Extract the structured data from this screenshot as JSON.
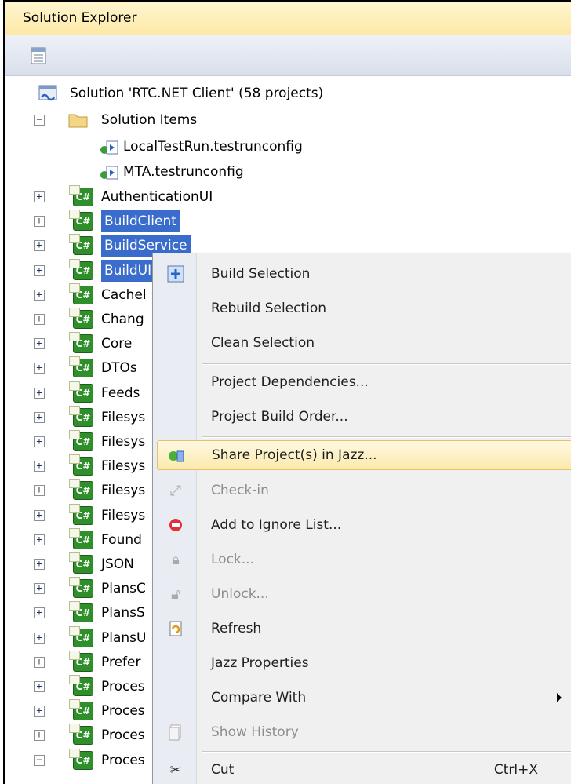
{
  "window": {
    "title": "Solution Explorer"
  },
  "toolbar": {
    "properties_icon": "properties-icon"
  },
  "solution": {
    "label": "Solution 'RTC.NET Client' (58 projects)",
    "items_folder": "Solution Items",
    "files": [
      "LocalTestRun.testrunconfig",
      "MTA.testrunconfig"
    ]
  },
  "projects": [
    "AuthenticationUI",
    "BuildClient",
    "BuildService",
    "BuildUI",
    "Cachel",
    "Chang",
    "Core",
    "DTOs",
    "Feeds",
    "Filesys",
    "Filesys",
    "Filesys",
    "Filesys",
    "Filesys",
    "Found",
    "JSON",
    "PlansC",
    "PlansS",
    "PlansU",
    "Prefer",
    "Proces",
    "Proces",
    "Proces",
    "Proces"
  ],
  "context_menu": {
    "items": [
      {
        "label": "Build Selection",
        "icon": "build-icon"
      },
      {
        "label": "Rebuild Selection"
      },
      {
        "label": "Clean Selection"
      },
      {
        "label": "Project Dependencies..."
      },
      {
        "label": "Project Build Order..."
      },
      {
        "label": "Share Project(s) in Jazz...",
        "icon": "share-jazz-icon"
      },
      {
        "label": "Check-in",
        "icon": "check-in-icon"
      },
      {
        "label": "Add to Ignore List...",
        "icon": "ignore-icon"
      },
      {
        "label": "Lock...",
        "icon": "lock-icon"
      },
      {
        "label": "Unlock...",
        "icon": "unlock-icon"
      },
      {
        "label": "Refresh",
        "icon": "refresh-icon"
      },
      {
        "label": "Jazz Properties"
      },
      {
        "label": "Compare With"
      },
      {
        "label": "Show History",
        "icon": "history-icon"
      },
      {
        "label": "Cut",
        "icon": "cut-icon",
        "shortcut": "Ctrl+X"
      }
    ]
  },
  "colors": {
    "selection": "#3a6ccc",
    "hover": "#fbe9ac",
    "menu_bg": "#f0f0f0"
  }
}
